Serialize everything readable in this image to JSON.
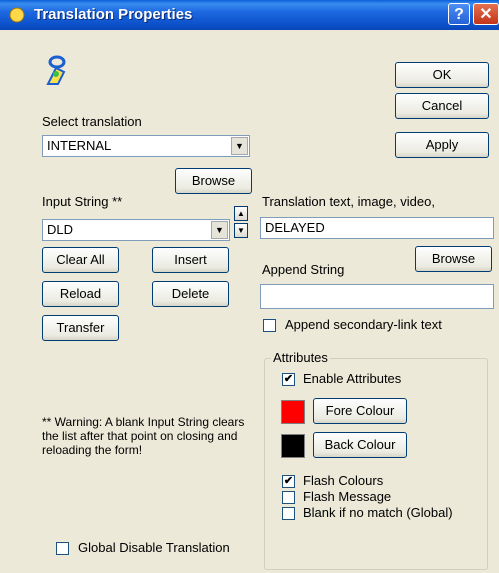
{
  "window": {
    "title": "Translation Properties",
    "help_glyph": "?",
    "close_glyph": "✕"
  },
  "buttons": {
    "ok": "OK",
    "cancel": "Cancel",
    "apply": "Apply",
    "browse_top": "Browse",
    "clear_all": "Clear All",
    "insert": "Insert",
    "reload": "Reload",
    "delete": "Delete",
    "transfer": "Transfer",
    "browse_right": "Browse",
    "fore_colour": "Fore Colour",
    "back_colour": "Back Colour"
  },
  "labels": {
    "select_translation": "Select translation",
    "input_string": "Input String **",
    "translation_text": "Translation text, image, video,",
    "append_string": "Append String",
    "attributes": "Attributes",
    "warning": "** Warning: A blank Input String clears the list after that point on closing and reloading the form!"
  },
  "fields": {
    "select_translation_value": "INTERNAL",
    "input_string_value": "DLD",
    "translation_text_value": "DELAYED",
    "append_string_value": ""
  },
  "checkboxes": {
    "append_secondary": {
      "label": "Append secondary-link text",
      "checked": false
    },
    "enable_attributes": {
      "label": "Enable Attributes",
      "checked": true
    },
    "flash_colours": {
      "label": "Flash Colours",
      "checked": true
    },
    "flash_message": {
      "label": "Flash Message",
      "checked": false
    },
    "blank_if_no_match": {
      "label": "Blank if no match (Global)",
      "checked": false
    },
    "global_disable": {
      "label": "Global Disable Translation",
      "checked": false
    }
  },
  "colors": {
    "fore": "#ff0000",
    "back": "#000000"
  },
  "icons": {
    "app_icon": "key-person-icon",
    "combo_arrow": "chevron-down-icon"
  }
}
